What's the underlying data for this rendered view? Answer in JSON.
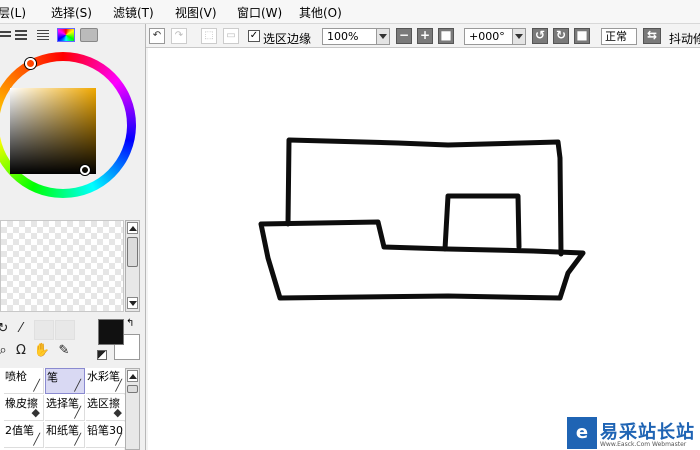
{
  "menubar": {
    "items": [
      "层(L)",
      "选择(S)",
      "滤镜(T)",
      "视图(V)",
      "窗口(W)",
      "其他(O)"
    ]
  },
  "toolbar": {
    "select_edge_label": "选区边缘",
    "select_edge_checked": true,
    "zoom": "100%",
    "rotation": "+000°",
    "blend_mode": "正常",
    "stabilizer_label": "抖动修"
  },
  "brushes": {
    "row1": [
      "喷枪",
      "笔",
      "水彩笔"
    ],
    "row2": [
      "橡皮擦",
      "选择笔",
      "选区擦"
    ],
    "row3": [
      "2值笔",
      "和纸笔",
      "铅笔30"
    ]
  },
  "watermark": {
    "text": "易采站长站",
    "subtext": "Www.Easck.Com  Webmaster"
  },
  "colors": {
    "foreground": "#111111",
    "background": "#ffffff",
    "selected_brush_bg": "#d9d9f3"
  },
  "icons": {
    "undo": "undo-icon",
    "redo": "redo-icon",
    "zoom_out": "minus-icon",
    "zoom_in": "plus-icon",
    "rotate_left": "rotate-left-icon",
    "rotate_right": "rotate-right-icon",
    "flip": "flip-horizontal-icon"
  }
}
